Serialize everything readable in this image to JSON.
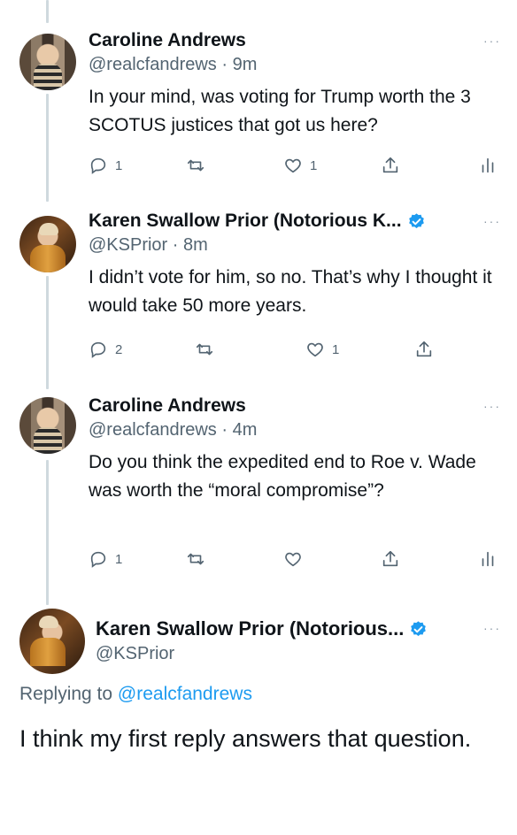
{
  "tweets": [
    {
      "name": "Caroline Andrews",
      "handle": "@realcfandrews",
      "time": "9m",
      "text": "In your mind, was voting for Trump worth the 3 SCOTUS justices that got us here?",
      "replies": "1",
      "retweets": "",
      "likes": "1",
      "verified": false,
      "avatar_icon": "caroline-avatar"
    },
    {
      "name": "Karen Swallow Prior (Notorious K...",
      "handle": "@KSPrior",
      "time": "8m",
      "text": "I didn’t vote for him, so no. That’s why I thought it would take 50 more years.",
      "replies": "2",
      "retweets": "",
      "likes": "1",
      "verified": true,
      "avatar_icon": "karen-avatar"
    },
    {
      "name": "Caroline Andrews",
      "handle": "@realcfandrews",
      "time": "4m",
      "text": "Do you think the expedited end to Roe v. Wade was worth the “moral compromise”?",
      "replies": "1",
      "retweets": "",
      "likes": "",
      "verified": false,
      "avatar_icon": "caroline-avatar"
    }
  ],
  "main_tweet": {
    "name": "Karen Swallow Prior (Notorious...",
    "handle": "@KSPrior",
    "replying_prefix": "Replying to",
    "replying_handle": "@realcfandrews",
    "text": "I think my first reply answers that question.",
    "verified": true
  },
  "more_glyph": "···",
  "dot_separator": " · ",
  "colors": {
    "text": "#0f1419",
    "secondary": "#536471",
    "accent": "#1d9bf0",
    "thread_line": "#cfd9de"
  }
}
